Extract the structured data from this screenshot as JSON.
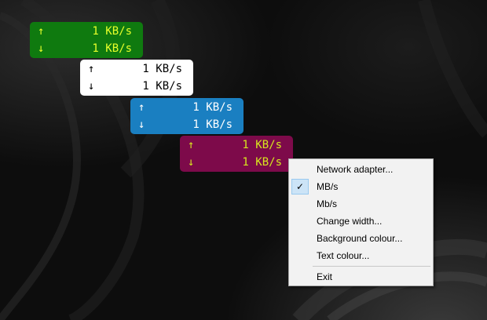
{
  "meters": [
    {
      "style": "green",
      "up_arrow": "↑",
      "down_arrow": "↓",
      "up_value": "1 KB/s",
      "down_value": "1 KB/s",
      "bg": "#0f7a0f",
      "fg": "#e6ff2a"
    },
    {
      "style": "white",
      "up_arrow": "↑",
      "down_arrow": "↓",
      "up_value": "1 KB/s",
      "down_value": "1 KB/s",
      "bg": "#ffffff",
      "fg": "#000000"
    },
    {
      "style": "blue",
      "up_arrow": "↑",
      "down_arrow": "↓",
      "up_value": "1 KB/s",
      "down_value": "1 KB/s",
      "bg": "#1a7fc1",
      "fg": "#ffffff"
    },
    {
      "style": "magenta",
      "up_arrow": "↑",
      "down_arrow": "↓",
      "up_value": "1 KB/s",
      "down_value": "1 KB/s",
      "bg": "#7d0a4a",
      "fg": "#d6e51f"
    }
  ],
  "context_menu": {
    "items": [
      {
        "label": "Network adapter...",
        "checked": false
      },
      {
        "label": "MB/s",
        "checked": true,
        "check_glyph": "✓"
      },
      {
        "label": "Mb/s",
        "checked": false
      },
      {
        "label": "Change width...",
        "checked": false
      },
      {
        "label": "Background colour...",
        "checked": false
      },
      {
        "label": "Text colour...",
        "checked": false
      }
    ],
    "exit_label": "Exit"
  }
}
